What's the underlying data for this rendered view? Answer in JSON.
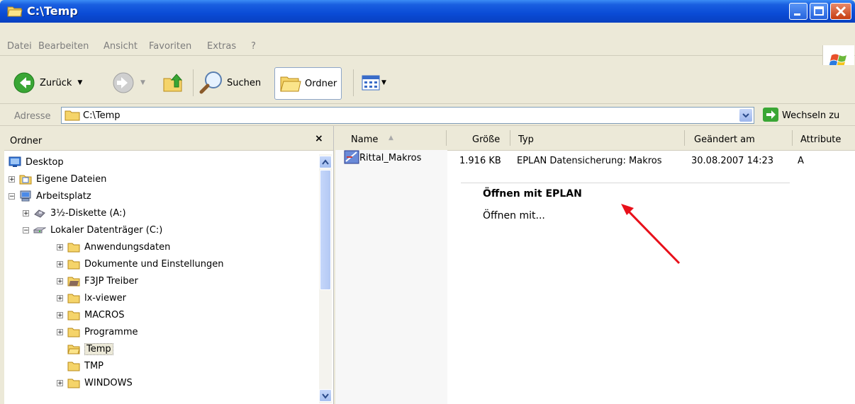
{
  "window": {
    "title": "C:\\Temp"
  },
  "menu": {
    "items": [
      "Datei",
      "Bearbeiten",
      "Ansicht",
      "Favoriten",
      "Extras",
      "?"
    ]
  },
  "toolbar": {
    "back_label": "Zurück",
    "search_label": "Suchen",
    "folders_label": "Ordner"
  },
  "address": {
    "label": "Adresse",
    "value": "C:\\Temp",
    "go_label": "Wechseln zu"
  },
  "folder_pane": {
    "title": "Ordner",
    "close_glyph": "×",
    "tree": [
      {
        "label": "Desktop",
        "icon": "desktop-icon",
        "expander": ""
      },
      {
        "label": "Eigene Dateien",
        "icon": "my-documents-icon",
        "expander": "+"
      },
      {
        "label": "Arbeitsplatz",
        "icon": "my-computer-icon",
        "expander": "−"
      },
      {
        "label": "3½-Diskette (A:)",
        "icon": "floppy-icon",
        "expander": "+"
      },
      {
        "label": "Lokaler Datenträger (C:)",
        "icon": "hard-drive-icon",
        "expander": "−"
      },
      {
        "label": "Anwendungsdaten",
        "icon": "folder-icon",
        "expander": "+"
      },
      {
        "label": "Dokumente und Einstellungen",
        "icon": "folder-icon",
        "expander": "+"
      },
      {
        "label": "F3JP Treiber",
        "icon": "folder-icon",
        "expander": "+"
      },
      {
        "label": "lx-viewer",
        "icon": "folder-icon",
        "expander": "+"
      },
      {
        "label": "MACROS",
        "icon": "folder-icon",
        "expander": "+"
      },
      {
        "label": "Programme",
        "icon": "folder-icon",
        "expander": "+"
      },
      {
        "label": "Temp",
        "icon": "open-folder-icon",
        "expander": ""
      },
      {
        "label": "TMP",
        "icon": "folder-icon",
        "expander": ""
      },
      {
        "label": "WINDOWS",
        "icon": "folder-icon",
        "expander": "+"
      }
    ]
  },
  "file_list": {
    "columns": [
      "Name",
      "Größe",
      "Typ",
      "Geändert am",
      "Attribute"
    ],
    "rows": [
      {
        "name": "Rittal_Makros",
        "size": "1.916 KB",
        "type": "EPLAN Datensicherung: Makros",
        "modified": "30.08.2007 14:23",
        "attr": "A"
      }
    ]
  },
  "context_menu": {
    "default_item": "Öffnen mit EPLAN",
    "open_with": "Öffnen mit..."
  },
  "colors": {
    "titlebar": "#0a4bd6",
    "annotation_arrow": "#e8101a",
    "chrome": "#ece9d8"
  }
}
